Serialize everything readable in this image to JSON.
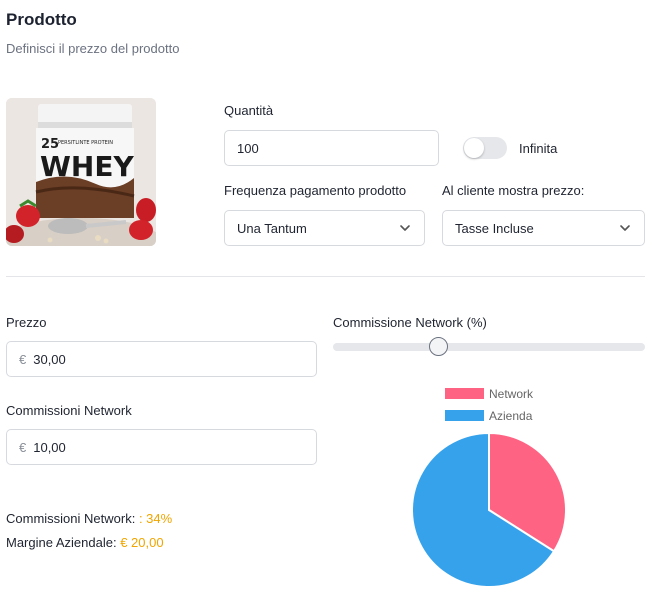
{
  "header": {
    "title": "Prodotto",
    "subtitle": "Definisci il prezzo del prodotto"
  },
  "product_image": {
    "brand_text": "25",
    "tag_text": "PERSITLINTE PROTEIN",
    "name_text": "WHEY"
  },
  "quantity": {
    "label": "Quantità",
    "value": "100"
  },
  "infinite_toggle": {
    "label": "Infinita",
    "on": false
  },
  "payment_frequency": {
    "label": "Frequenza pagamento prodotto",
    "selected": "Una Tantum"
  },
  "price_display": {
    "label": "Al cliente mostra prezzo:",
    "selected": "Tasse Incluse"
  },
  "price": {
    "label": "Prezzo",
    "currency": "€",
    "value": "30,00"
  },
  "network_commission_slider": {
    "label": "Commissione Network (%)",
    "value_percent": 34
  },
  "network_commission": {
    "label": "Commissioni Network",
    "currency": "€",
    "value": "10,00"
  },
  "summary": {
    "commission_label": "Commissioni Network:",
    "commission_value": ": 34%",
    "margin_label": "Margine Aziendale:",
    "margin_value": "€ 20,00",
    "accent_color": "#f0a500"
  },
  "chart_data": {
    "type": "pie",
    "categories": [
      "Network",
      "Azienda"
    ],
    "values": [
      34,
      66
    ],
    "colors": [
      "#ff6384",
      "#36a2eb"
    ],
    "legend": "top"
  }
}
